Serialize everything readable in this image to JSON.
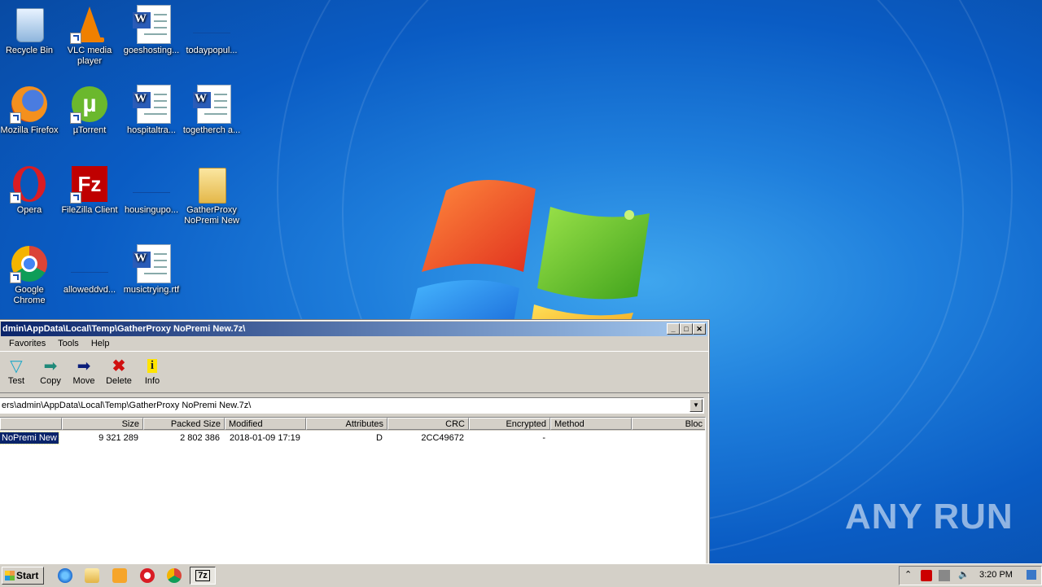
{
  "desktop": {
    "icons": [
      {
        "label": "Recycle Bin"
      },
      {
        "label": "VLC media player"
      },
      {
        "label": "goeshosting..."
      },
      {
        "label": "todaypopul..."
      },
      {
        "label": "Mozilla Firefox"
      },
      {
        "label": "µTorrent"
      },
      {
        "label": "hospitaltra..."
      },
      {
        "label": "togetherch a..."
      },
      {
        "label": "Opera"
      },
      {
        "label": "FileZilla Client"
      },
      {
        "label": "housingupo..."
      },
      {
        "label": "GatherProxy NoPremi New"
      },
      {
        "label": "Google Chrome"
      },
      {
        "label": "alloweddvd..."
      },
      {
        "label": "musictrying.rtf"
      }
    ]
  },
  "window": {
    "title": "dmin\\AppData\\Local\\Temp\\GatherProxy NoPremi New.7z\\",
    "menu": [
      "Favorites",
      "Tools",
      "Help"
    ],
    "toolbar": [
      {
        "label": "Test",
        "icon": "check-icon"
      },
      {
        "label": "Copy",
        "icon": "copy-arrow-icon"
      },
      {
        "label": "Move",
        "icon": "move-arrow-icon"
      },
      {
        "label": "Delete",
        "icon": "delete-x-icon"
      },
      {
        "label": "Info",
        "icon": "info-icon"
      }
    ],
    "address": "ers\\admin\\AppData\\Local\\Temp\\GatherProxy NoPremi New.7z\\",
    "columns": [
      "Size",
      "Packed Size",
      "Modified",
      "Attributes",
      "CRC",
      "Encrypted",
      "Method",
      "Bloc"
    ],
    "rows": [
      {
        "name": "NoPremi New",
        "size": "9 321 289",
        "packed": "2 802 386",
        "modified": "2018-01-09 17:19",
        "attributes": "D",
        "crc": "2CC49672",
        "encrypted": "-",
        "method": ""
      }
    ]
  },
  "taskbar": {
    "start_label": "Start",
    "active_task": "7z",
    "clock": "3:20 PM"
  },
  "watermark": "ANY RUN"
}
